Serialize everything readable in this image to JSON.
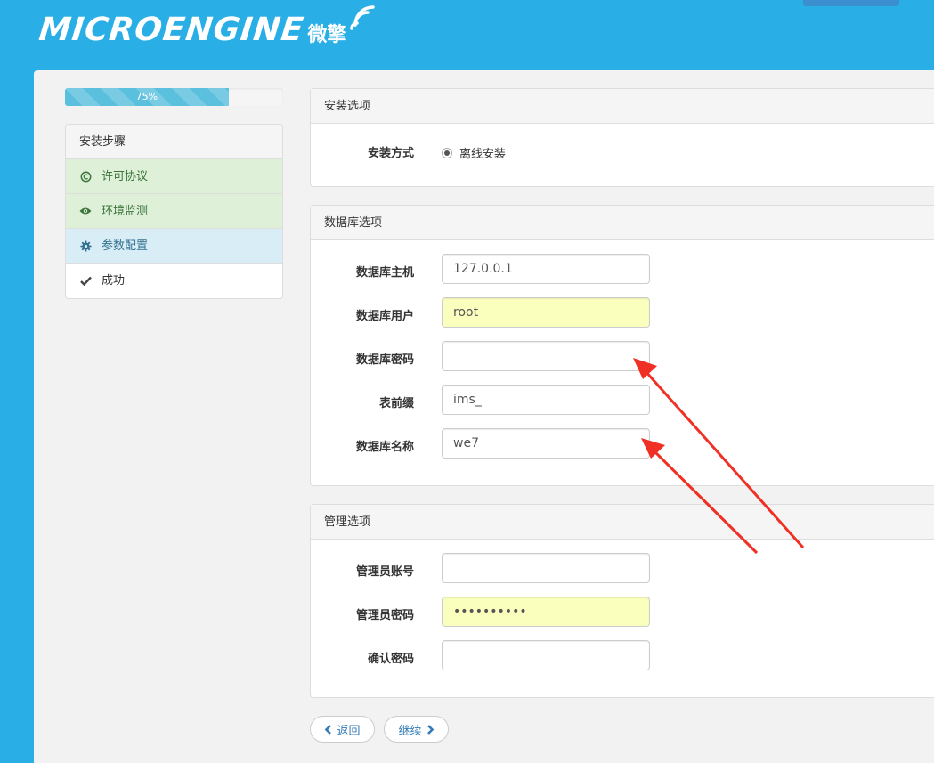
{
  "header": {
    "logo_text": "MICROENGINE",
    "logo_cn": "微擎"
  },
  "progress": {
    "percent": 75,
    "label": "75%"
  },
  "steps": {
    "heading": "安装步骤",
    "items": [
      {
        "label": "许可协议",
        "icon": "copyright-icon",
        "state": "done"
      },
      {
        "label": "环境监测",
        "icon": "eye-icon",
        "state": "done"
      },
      {
        "label": "参数配置",
        "icon": "gear-icon",
        "state": "active"
      },
      {
        "label": "成功",
        "icon": "check-icon",
        "state": "pending"
      }
    ]
  },
  "install_options": {
    "heading": "安装选项",
    "method_label": "安装方式",
    "method_value": "离线安装"
  },
  "database": {
    "heading": "数据库选项",
    "host_label": "数据库主机",
    "host_value": "127.0.0.1",
    "user_label": "数据库用户",
    "user_value": "root",
    "password_label": "数据库密码",
    "password_value": "",
    "prefix_label": "表前缀",
    "prefix_value": "ims_",
    "name_label": "数据库名称",
    "name_value": "we7"
  },
  "admin": {
    "heading": "管理选项",
    "account_label": "管理员账号",
    "account_value": "",
    "password_label": "管理员密码",
    "password_value": "••••••••••",
    "confirm_label": "确认密码",
    "confirm_value": ""
  },
  "buttons": {
    "back": "返回",
    "next": "继续"
  },
  "colors": {
    "header_bg": "#29aee6",
    "done_bg": "#dff0d8",
    "active_bg": "#d9edf7",
    "autofill_bg": "#faffbd",
    "arrow": "#f03024"
  }
}
